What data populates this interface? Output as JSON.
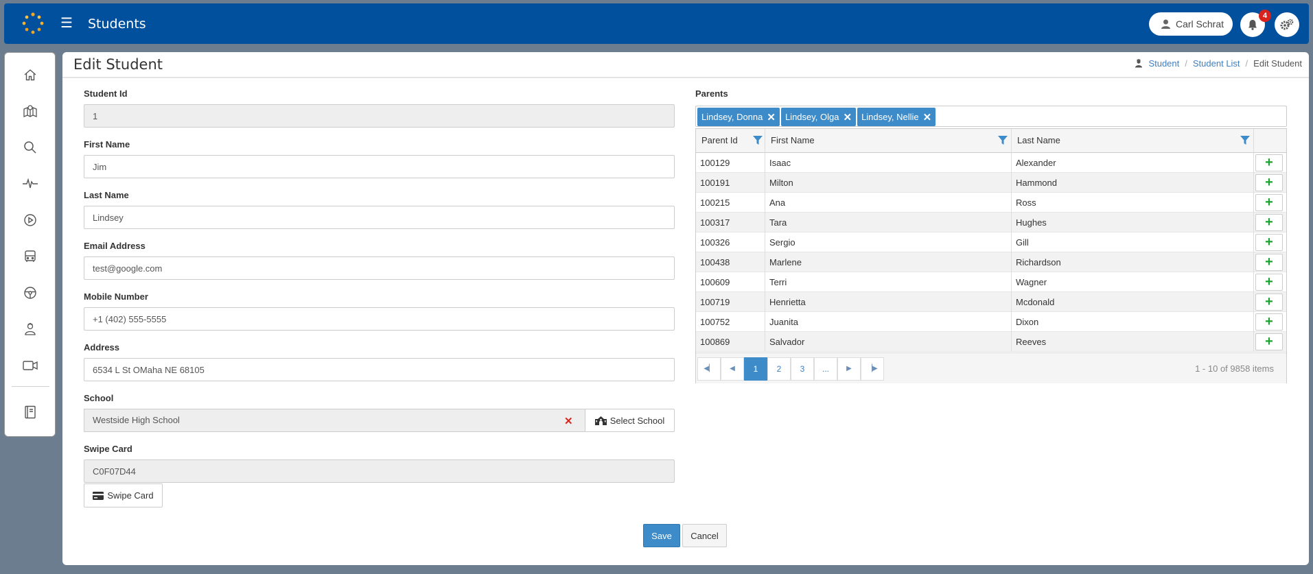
{
  "header": {
    "app_title": "Students",
    "user_name": "Carl Schrat",
    "notification_count": "4",
    "brand_color": "#00509e"
  },
  "sidebar": {
    "items": [
      {
        "icon": "home-icon"
      },
      {
        "icon": "map-icon"
      },
      {
        "icon": "search-icon"
      },
      {
        "icon": "pulse-icon"
      },
      {
        "icon": "play-circle-icon"
      },
      {
        "icon": "bus-icon"
      },
      {
        "icon": "steering-wheel-icon"
      },
      {
        "icon": "student-icon"
      },
      {
        "icon": "video-camera-icon"
      },
      {
        "icon": "book-icon"
      }
    ]
  },
  "page": {
    "title": "Edit Student",
    "breadcrumb": {
      "root": "Student",
      "list": "Student List",
      "current": "Edit Student"
    }
  },
  "form": {
    "student_id": {
      "label": "Student Id",
      "value": "1"
    },
    "first_name": {
      "label": "First Name",
      "value": "Jim"
    },
    "last_name": {
      "label": "Last Name",
      "value": "Lindsey"
    },
    "email": {
      "label": "Email Address",
      "value": "test@google.com"
    },
    "mobile": {
      "label": "Mobile Number",
      "value": "+1 (402) 555-5555"
    },
    "address": {
      "label": "Address",
      "value": "6534 L St OMaha NE 68105"
    },
    "school": {
      "label": "School",
      "value": "Westside High School",
      "clear": "✕",
      "select_label": "Select School"
    },
    "swipe_card": {
      "label": "Swipe Card",
      "value": "C0F07D44",
      "button_label": "Swipe Card"
    },
    "save_label": "Save",
    "cancel_label": "Cancel"
  },
  "parents": {
    "label": "Parents",
    "selected": [
      "Lindsey, Donna",
      "Lindsey, Olga",
      "Lindsey, Nellie"
    ],
    "columns": [
      "Parent Id",
      "First Name",
      "Last Name"
    ],
    "rows": [
      [
        "100129",
        "Isaac",
        "Alexander"
      ],
      [
        "100191",
        "Milton",
        "Hammond"
      ],
      [
        "100215",
        "Ana",
        "Ross"
      ],
      [
        "100317",
        "Tara",
        "Hughes"
      ],
      [
        "100326",
        "Sergio",
        "Gill"
      ],
      [
        "100438",
        "Marlene",
        "Richardson"
      ],
      [
        "100609",
        "Terri",
        "Wagner"
      ],
      [
        "100719",
        "Henrietta",
        "Mcdonald"
      ],
      [
        "100752",
        "Juanita",
        "Dixon"
      ],
      [
        "100869",
        "Salvador",
        "Reeves"
      ]
    ],
    "pager": {
      "pages": [
        "1",
        "2",
        "3",
        "..."
      ],
      "current": "1",
      "info": "1 - 10 of 9858 items"
    }
  }
}
